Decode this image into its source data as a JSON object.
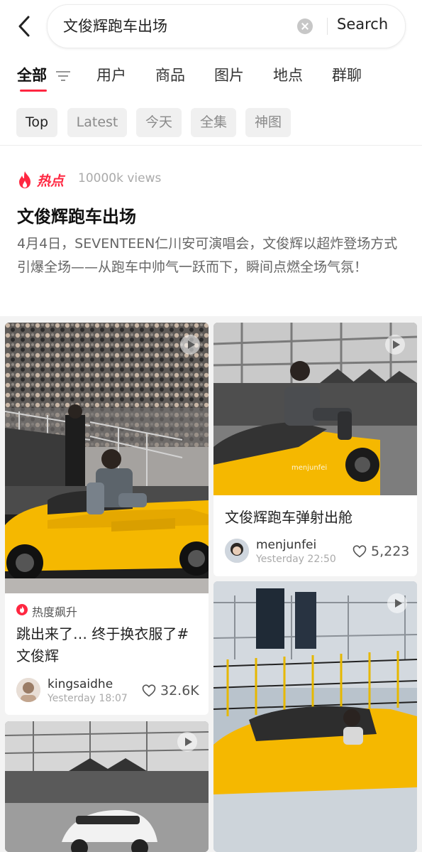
{
  "search": {
    "query": "文俊辉跑车出场",
    "button_label": "Search"
  },
  "tabs": [
    "全部",
    "用户",
    "商品",
    "图片",
    "地点",
    "群聊"
  ],
  "chips": [
    "Top",
    "Latest",
    "今天",
    "全集",
    "神图"
  ],
  "hot": {
    "badge": "热点",
    "views": "10000k views",
    "title": "文俊辉跑车出场",
    "description": "4月4日，SEVENTEEN仁川安可演唱会，文俊辉以超炸登场方式引爆全场——从跑车中帅气一跃而下，瞬间点燃全场气氛！"
  },
  "posts": [
    {
      "title": "跳出来了… 终于换衣服了#文俊辉",
      "trend": "热度飙升",
      "author": "kingsaidhe",
      "time": "Yesterday 18:07",
      "likes": "32.6K"
    },
    {
      "title": "文俊辉跑车弹射出舱",
      "author": "menjunfei",
      "time": "Yesterday 22:50",
      "likes": "5,223",
      "watermark": "menjunfei"
    }
  ],
  "colors": {
    "accent": "#ff2741",
    "car_yellow": "#f5b800"
  }
}
